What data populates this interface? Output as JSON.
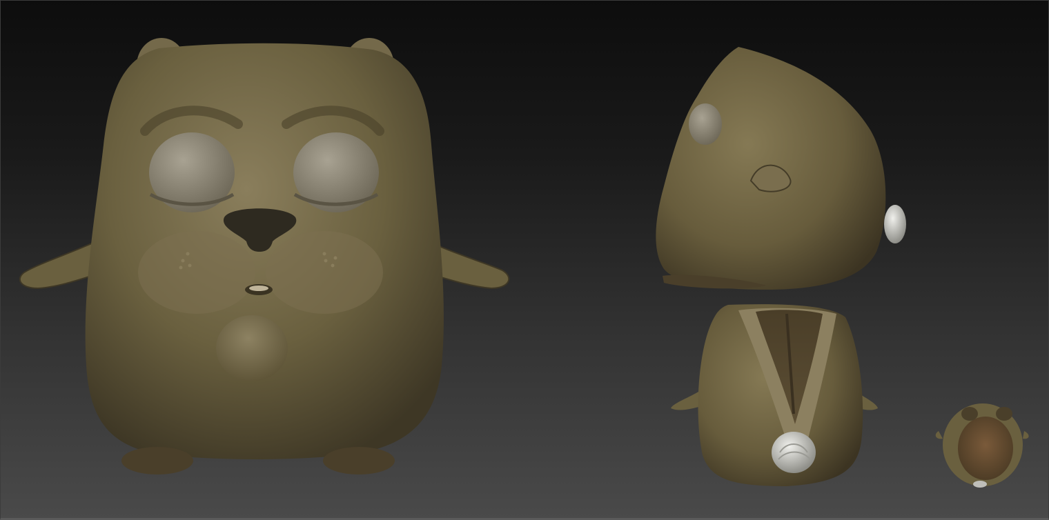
{
  "scene": {
    "views": [
      {
        "id": "front-view"
      },
      {
        "id": "side-view"
      },
      {
        "id": "back-view"
      },
      {
        "id": "bottom-view"
      }
    ],
    "colors": {
      "clay_base": "#6e6448",
      "clay_light": "#968a68",
      "clay_shadow": "#3a3322",
      "eye_clay": "#8e8878",
      "nose_dark": "#2e2a20",
      "tail_white": "#d8d8d4"
    }
  }
}
